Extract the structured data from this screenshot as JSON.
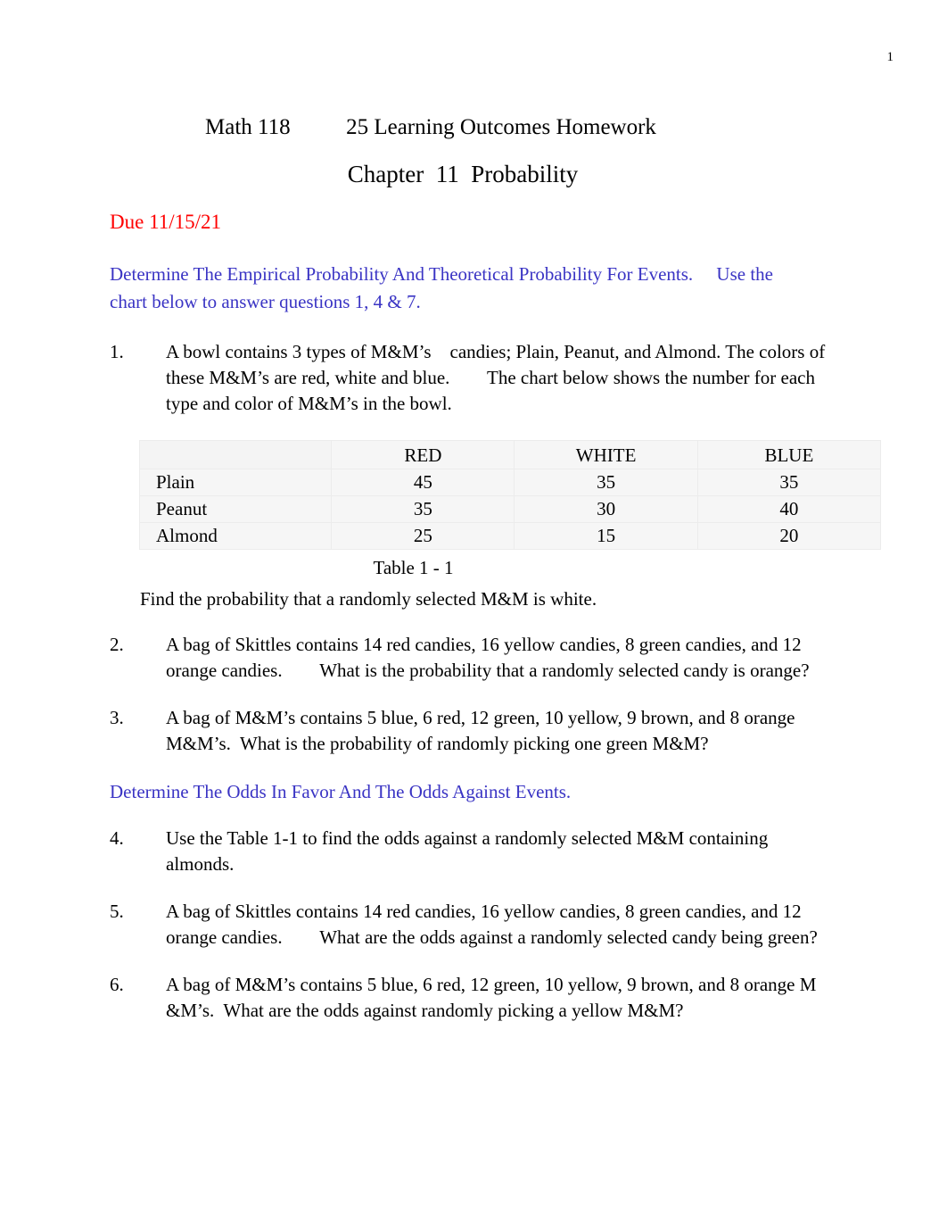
{
  "page": {
    "number": "1"
  },
  "header": {
    "title": "Math 118          25 Learning Outcomes Homework",
    "chapter_title": "Chapter  11  Probability",
    "due": "Due 11/15/21",
    "due_color": "#ff0000",
    "heading_color": "#3a34c4"
  },
  "sections": [
    {
      "heading": "Determine The Empirical Probability And Theoretical Probability For Events.     Use the chart below to answer questions 1, 4 & 7."
    },
    {
      "heading": "Determine The Odds In Favor And The Odds Against Events."
    }
  ],
  "questions": [
    {
      "number": "1.",
      "text": "A bowl contains 3 types of M&M’s    candies; Plain, Peanut, and Almond. The colors of these M&M’s are red, white and blue.        The chart below shows the number for each type and color of M&M’s in the bowl."
    },
    {
      "number": "2.",
      "text": "A bag of Skittles contains 14 red candies, 16 yellow candies, 8 green candies, and 12 orange candies.        What is the probability that a randomly selected candy is orange?"
    },
    {
      "number": "3.",
      "text": "A bag of M&M’s contains 5 blue, 6 red, 12 green, 10 yellow, 9 brown, and 8 orange    M&M’s.  What is the probability of randomly picking one green M&M?"
    },
    {
      "number": "4.",
      "text": "Use the Table 1-1 to find the odds against a randomly selected M&M containing almonds."
    },
    {
      "number": "5.",
      "text": "A bag of Skittles contains 14 red candies, 16 yellow candies, 8 green candies, and 12 orange candies.        What are the odds against a randomly selected candy being green?"
    },
    {
      "number": "6.",
      "text": "A bag of M&M’s contains 5 blue, 6 red, 12 green, 10 yellow, 9 brown, and 8 orange M   &M’s.  What are the odds against randomly picking a yellow M&M?"
    }
  ],
  "prompt_after_table": "Find the probability that a randomly selected M&M is white.",
  "table": {
    "caption": "Table 1 - 1",
    "corner_label": "",
    "columns": [
      "RED",
      "WHITE",
      "BLUE"
    ],
    "rows": [
      {
        "label": "Plain",
        "values": [
          "45",
          "35",
          "35"
        ]
      },
      {
        "label": "Peanut",
        "values": [
          "35",
          "30",
          "40"
        ]
      },
      {
        "label": "Almond",
        "values": [
          "25",
          "15",
          "20"
        ]
      }
    ]
  }
}
